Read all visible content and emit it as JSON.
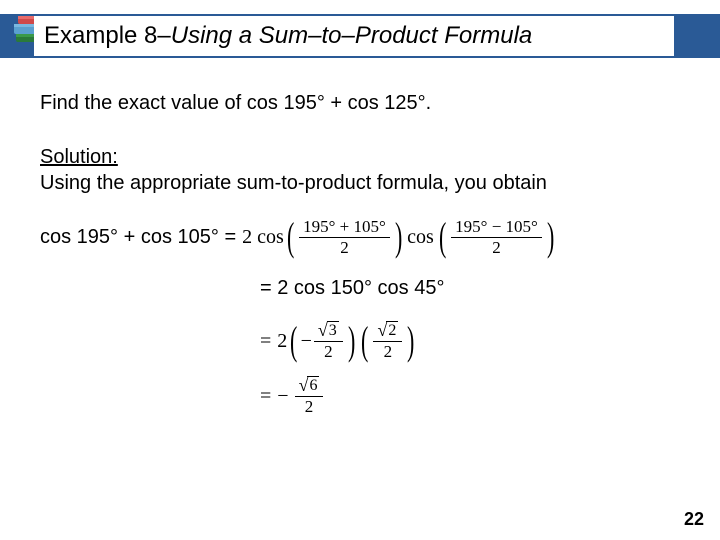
{
  "header": {
    "example_label": "Example 8",
    "separator": " – ",
    "subtitle": "Using a Sum–to–Product Formula"
  },
  "problem": {
    "text": "Find the exact value of cos 195° + cos 125°."
  },
  "solution": {
    "label": "Solution:",
    "intro": "Using the appropriate sum-to-product formula, you obtain",
    "step1": {
      "lhs": "cos 195° + cos 105° =",
      "coef": "2 cos",
      "frac1_num": "195° + 105°",
      "frac1_den": "2",
      "mid": "cos",
      "frac2_num": "195° − 105°",
      "frac2_den": "2"
    },
    "step2": {
      "text": "= 2 cos 150° cos 45°"
    },
    "step3": {
      "eq": "=",
      "coef": "2",
      "neg": "−",
      "r1_rad": "3",
      "r1_den": "2",
      "r2_rad": "2",
      "r2_den": "2"
    },
    "step4": {
      "eq": "=",
      "neg": "−",
      "num_rad": "6",
      "den": "2"
    }
  },
  "page": "22"
}
